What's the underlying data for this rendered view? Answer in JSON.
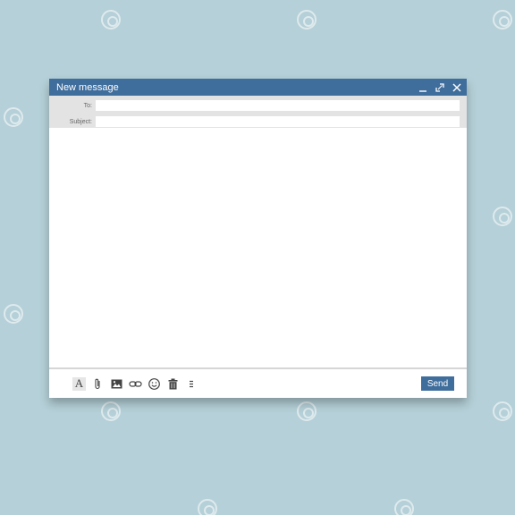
{
  "window": {
    "title": "New message"
  },
  "fields": {
    "to_label": "To:",
    "to_value": "",
    "subject_label": "Subject:",
    "subject_value": ""
  },
  "message": {
    "body": ""
  },
  "toolbar": {
    "format_label": "A",
    "icons": [
      "format-text-icon",
      "attachment-icon",
      "image-icon",
      "link-icon",
      "emoji-icon",
      "trash-icon",
      "more-options-icon"
    ]
  },
  "actions": {
    "send_label": "Send"
  },
  "colors": {
    "background": "#b5d0d8",
    "accent": "#3f6d9c",
    "header_bg": "#e3e3e3"
  }
}
